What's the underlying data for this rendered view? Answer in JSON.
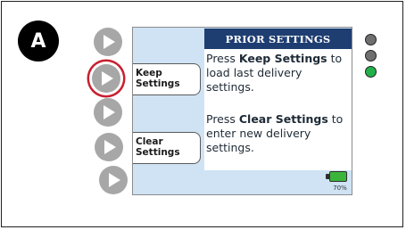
{
  "panel_label": "A",
  "screen": {
    "title": "PRIOR SETTINGS",
    "message1": {
      "pre": "Press ",
      "bold": "Keep Settings",
      "post": " to load last delivery settings."
    },
    "message2": {
      "pre": "Press ",
      "bold": "Clear Settings",
      "post": " to enter new delivery settings."
    },
    "keep_label": [
      "Keep",
      "Settings"
    ],
    "clear_label": [
      "Clear",
      "Settings"
    ],
    "battery_percent": "70%"
  },
  "softkeys": [
    "softkey-1",
    "softkey-2",
    "softkey-3",
    "softkey-4",
    "softkey-5"
  ],
  "highlighted_softkey": 2,
  "colors": {
    "title_bar": "#1e3e72",
    "highlight_ring": "#c8202f",
    "led_gray": "#6f6f6f",
    "led_green": "#22b04b",
    "battery_fill": "#3cb43c"
  },
  "leds": [
    "gray",
    "gray",
    "green"
  ]
}
